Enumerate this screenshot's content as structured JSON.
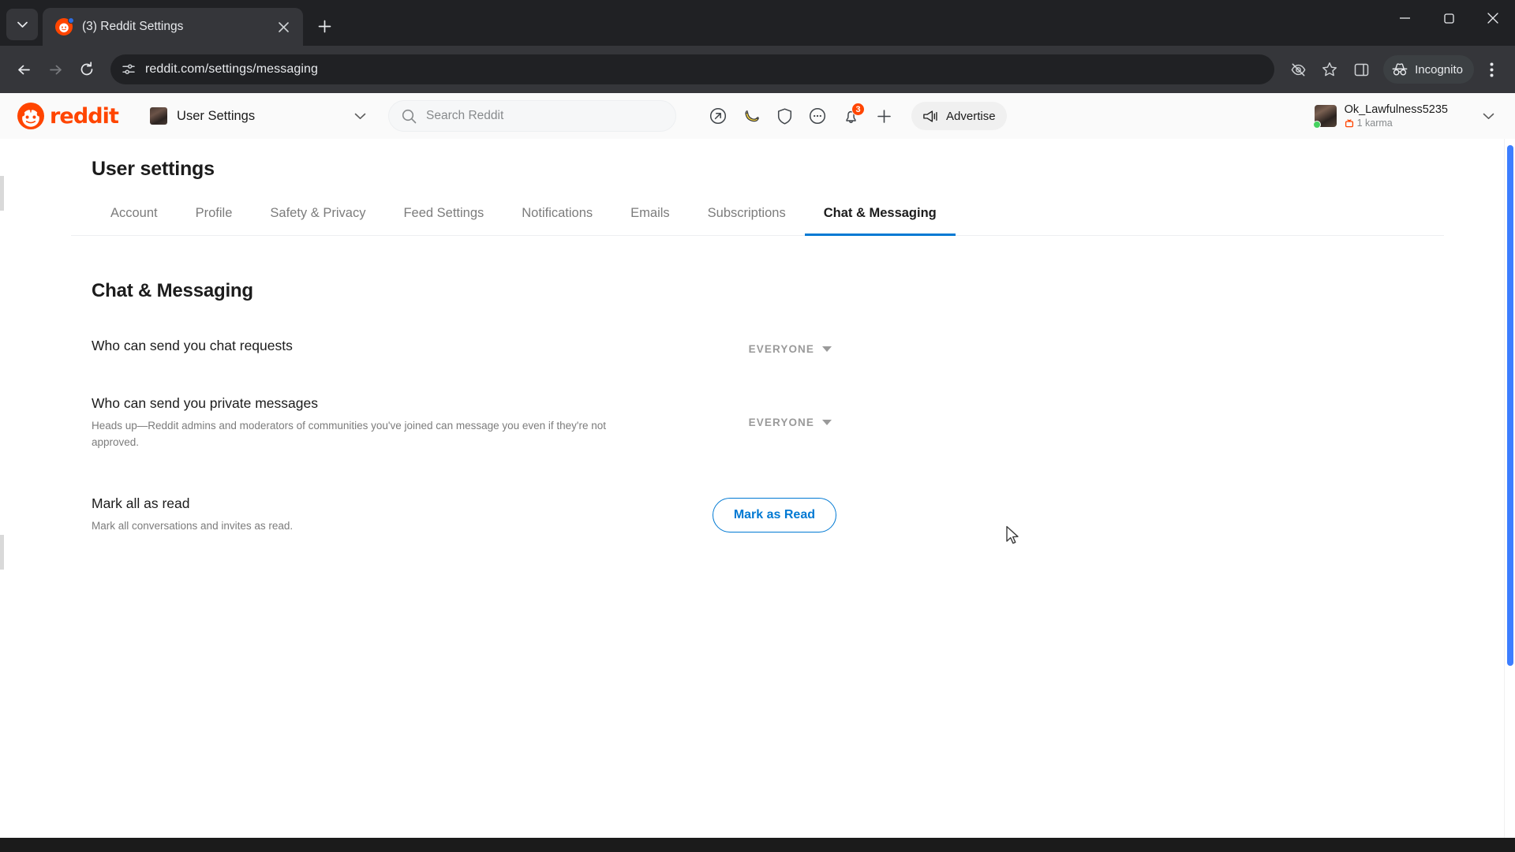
{
  "browser": {
    "tab": {
      "title": "(3) Reddit Settings",
      "favicon": "reddit-favicon",
      "close_icon": "close-icon"
    },
    "tab_search_icon": "chevron-down-icon",
    "new_tab_icon": "plus-icon",
    "nav": {
      "back_icon": "back-arrow-icon",
      "forward_icon": "forward-arrow-icon",
      "reload_icon": "reload-icon"
    },
    "omnibox": {
      "url": "reddit.com/settings/messaging",
      "site_settings_icon": "tune-icon"
    },
    "actions": {
      "tracking_icon": "eye-off-icon",
      "bookmark_icon": "star-icon",
      "side_panel_icon": "side-panel-icon",
      "menu_icon": "three-dot-menu-icon"
    },
    "incognito": {
      "label": "Incognito",
      "icon": "incognito-icon"
    },
    "window": {
      "minimize_icon": "minimize-icon",
      "maximize_icon": "maximize-icon",
      "close_icon": "window-close-icon"
    }
  },
  "reddit_header": {
    "logo_text": "reddit",
    "logo_icon": "reddit-snoo-icon",
    "community": {
      "label": "User Settings",
      "avatar": "community-avatar",
      "chevron_icon": "chevron-down-icon"
    },
    "search": {
      "placeholder": "Search Reddit",
      "value": "",
      "icon": "search-icon"
    },
    "nav_icons": [
      {
        "name": "popular-icon",
        "badge": ""
      },
      {
        "name": "gold-banana-icon",
        "badge": ""
      },
      {
        "name": "mod-shield-icon",
        "badge": ""
      },
      {
        "name": "chat-icon",
        "badge": ""
      },
      {
        "name": "notifications-bell-icon",
        "badge": "3"
      },
      {
        "name": "create-post-plus-icon",
        "badge": ""
      }
    ],
    "advertise": {
      "label": "Advertise",
      "icon": "megaphone-icon"
    },
    "user": {
      "name": "Ok_Lawfulness5235",
      "karma": "1 karma",
      "karma_icon": "karma-icon",
      "avatar": "user-avatar",
      "online": true,
      "chevron_icon": "chevron-down-icon"
    }
  },
  "page": {
    "title": "User settings",
    "tabs": [
      {
        "label": "Account",
        "active": false
      },
      {
        "label": "Profile",
        "active": false
      },
      {
        "label": "Safety & Privacy",
        "active": false
      },
      {
        "label": "Feed Settings",
        "active": false
      },
      {
        "label": "Notifications",
        "active": false
      },
      {
        "label": "Emails",
        "active": false
      },
      {
        "label": "Subscriptions",
        "active": false
      },
      {
        "label": "Chat & Messaging",
        "active": true
      }
    ],
    "section_title": "Chat & Messaging",
    "settings": [
      {
        "label": "Who can send you chat requests",
        "desc": "",
        "control": "dropdown",
        "value": "EVERYONE"
      },
      {
        "label": "Who can send you private messages",
        "desc": "Heads up—Reddit admins and moderators of communities you've joined can message you even if they're not approved.",
        "control": "dropdown",
        "value": "EVERYONE"
      },
      {
        "label": "Mark all as read",
        "desc": "Mark all conversations and invites as read.",
        "control": "button",
        "value": "Mark as Read"
      }
    ]
  },
  "colors": {
    "reddit_orange": "#ff4500",
    "link_blue": "#0079d3",
    "chrome_dark": "#202124",
    "toolbar_dark": "#35363a",
    "scrollbar_blue": "#3d7eff"
  }
}
